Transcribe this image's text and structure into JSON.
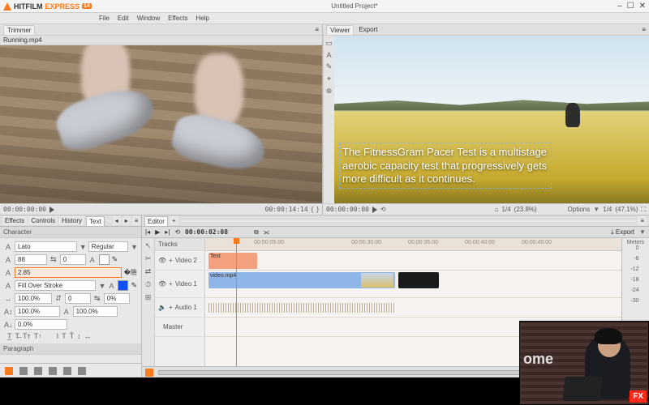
{
  "brand": {
    "name": "HITFILM",
    "edition": "EXPRESS",
    "badge": "14"
  },
  "window": {
    "title": "Untitled Project*",
    "buttons": [
      "–",
      "☐",
      "✕"
    ]
  },
  "menu": [
    "File",
    "Edit",
    "Window",
    "Effects",
    "Help"
  ],
  "trimmer": {
    "tab": "Trimmer",
    "clip_name": "Running.mp4",
    "tc_in": "00:00:00:00",
    "tc_out": "00:00:14:14"
  },
  "viewer": {
    "tabs": [
      "Viewer",
      "Export"
    ],
    "caption": "The FitnessGram Pacer Test is a multistage aerobic capacity test that progressively gets more difficult as it continues.",
    "tc": "00:00:00:00",
    "scale_left": "1/4",
    "zoom_left": "(23.8%)",
    "options": "Options",
    "scale_right": "1/4",
    "zoom_right": "(47.1%)",
    "tools": [
      "▭",
      "A",
      "✎",
      "⌖",
      "⊕"
    ]
  },
  "inspector": {
    "tabs": [
      "Effects",
      "Controls",
      "History",
      "Text"
    ],
    "active_tab": "Text",
    "section": "Character",
    "font": "Lato",
    "weight": "Regular",
    "size": "88",
    "kern": "0",
    "fill_hex": "#ffffff",
    "stroke": "2.85",
    "stroke_mode": "Fill Over Stroke",
    "stroke_hex": "#1050ff",
    "scale_x": "100.0%",
    "baseline": "0",
    "tracking": "0%",
    "scale_y": "100.0%",
    "leading": "100.0%",
    "shift": "0.0%",
    "style_btns": [
      "T̲",
      "Ṯ",
      "T̶",
      "T↕",
      "   ",
      "I",
      "T",
      "T̂",
      "↕",
      "↔"
    ],
    "section2": "Paragraph"
  },
  "timeline": {
    "tab": "Editor",
    "tc": "00:00:02:08",
    "export": "Export",
    "ruler": [
      "00:00:05:00",
      "00:00:30:00",
      "00:00:35:00",
      "00:00:40:00",
      "00:00:45:00"
    ],
    "tracks_header": "Tracks",
    "tracks": [
      {
        "name": "Video 2",
        "clip": "Text"
      },
      {
        "name": "Video 1",
        "clip": "video.mp4"
      },
      {
        "name": "Audio 1"
      },
      {
        "name": "Master"
      }
    ],
    "meters": {
      "label": "Meters",
      "ticks": [
        "0",
        "-6",
        "-12",
        "-18",
        "-24",
        "-30"
      ]
    }
  },
  "webcam": {
    "word": "ome",
    "badge": "FX"
  }
}
